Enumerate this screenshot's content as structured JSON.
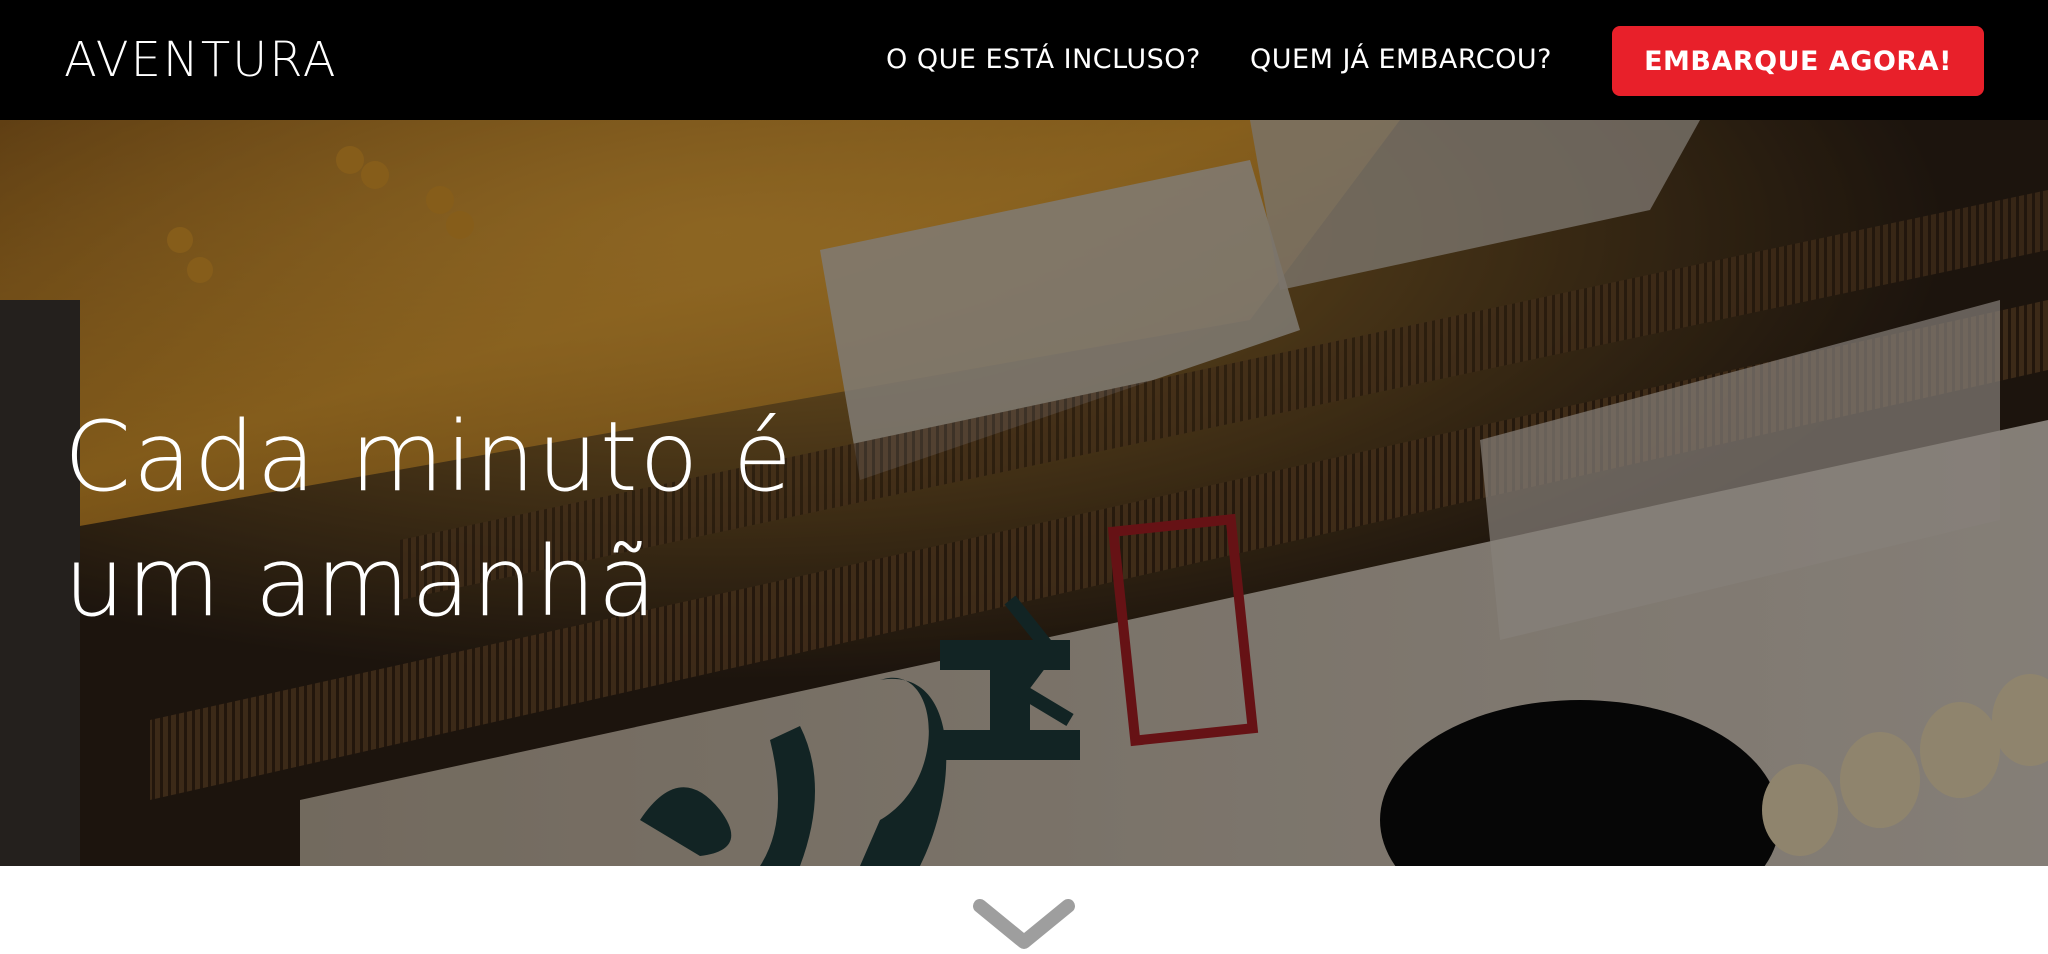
{
  "navbar": {
    "brand": "AVENTURA",
    "links": [
      "O QUE ESTÁ INCLUSO?",
      "QUEM JÁ EMBARCOU?"
    ],
    "cta_label": "EMBARQUE AGORA!",
    "background": "#000000",
    "accent": "#e8202a"
  },
  "hero": {
    "title_line1": "Cada minuto é",
    "title_line2": "um amanhã",
    "image_description_icon": "japanese-storefront-photo"
  },
  "scroll": {
    "icon": "chevron-down-icon",
    "color": "#9e9e9e"
  }
}
